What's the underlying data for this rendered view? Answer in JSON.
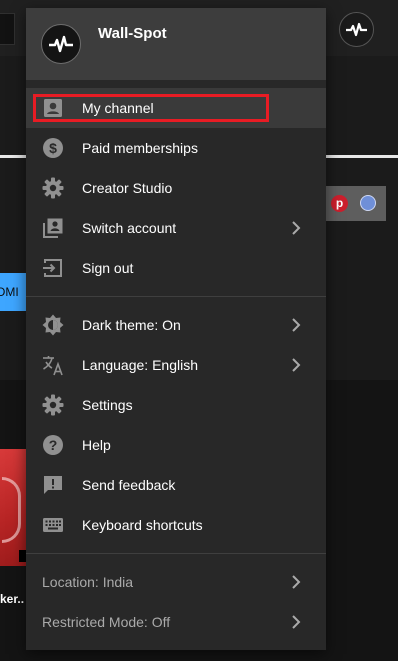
{
  "background": {
    "partial_video_title": "ker..",
    "partial_button_text": "OMI"
  },
  "account": {
    "name": "Wall-Spot"
  },
  "menu": {
    "section1": [
      {
        "label": "My channel",
        "icon": "person-box-icon",
        "active": true
      },
      {
        "label": "Paid memberships",
        "icon": "dollar-icon"
      },
      {
        "label": "Creator Studio",
        "icon": "gear-icon"
      },
      {
        "label": "Switch account",
        "icon": "switch-account-icon",
        "chevron": true
      },
      {
        "label": "Sign out",
        "icon": "sign-out-icon"
      }
    ],
    "section2": [
      {
        "label": "Dark theme: On",
        "icon": "theme-icon",
        "chevron": true
      },
      {
        "label": "Language: English",
        "icon": "translate-icon",
        "chevron": true
      },
      {
        "label": "Settings",
        "icon": "gear-icon"
      },
      {
        "label": "Help",
        "icon": "help-icon"
      },
      {
        "label": "Send feedback",
        "icon": "feedback-icon"
      },
      {
        "label": "Keyboard shortcuts",
        "icon": "keyboard-icon"
      }
    ],
    "footer": [
      {
        "label": "Location: India",
        "chevron": true
      },
      {
        "label": "Restricted Mode: Off",
        "chevron": true
      }
    ]
  },
  "colors": {
    "highlight_border": "#e81c24",
    "menu_bg": "#282828",
    "header_bg": "#3d3d3d"
  }
}
